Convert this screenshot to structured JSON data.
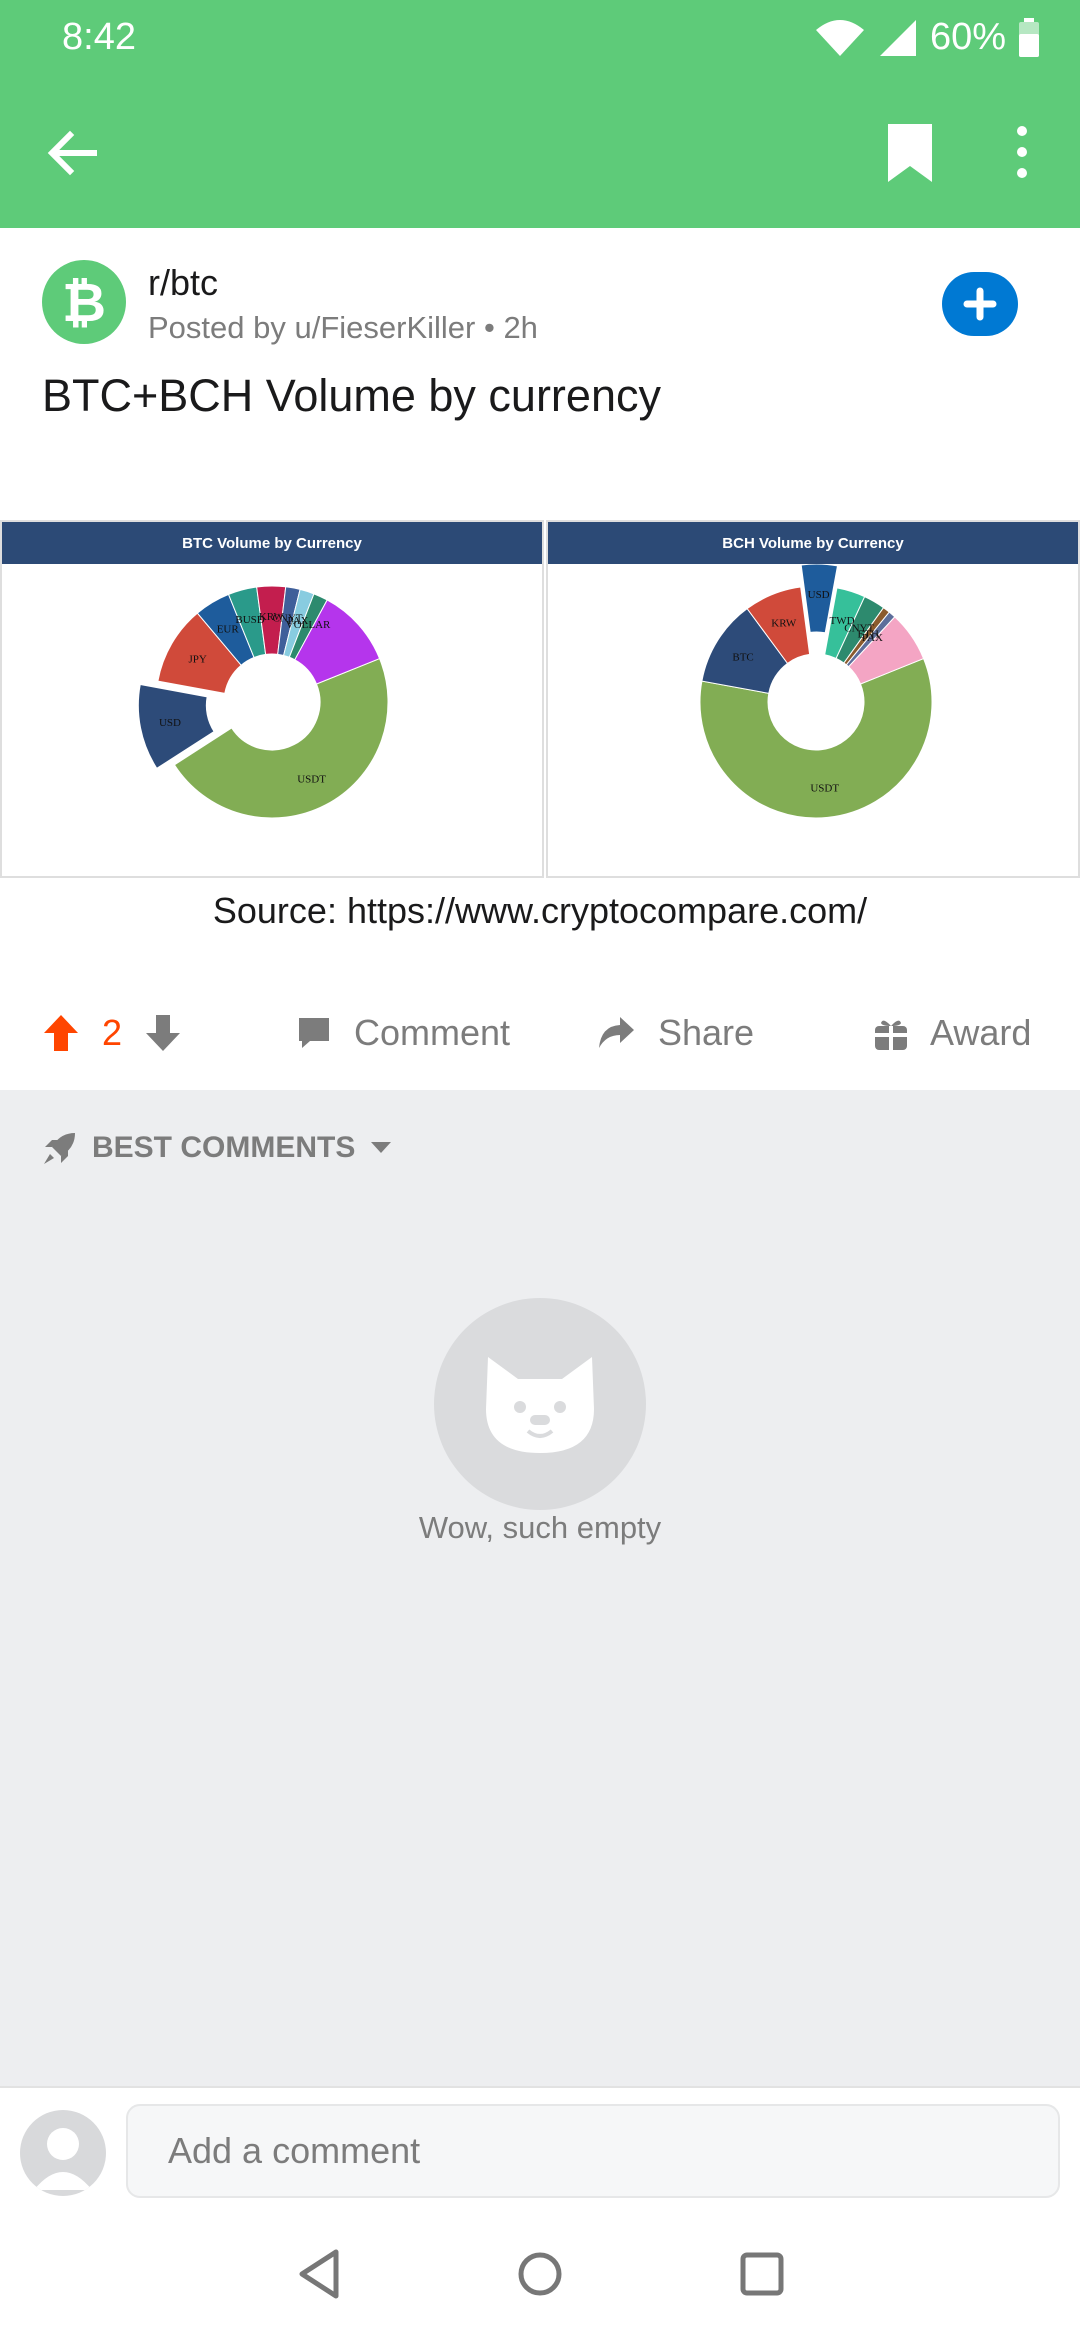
{
  "status_bar": {
    "time": "8:42",
    "battery": "60%"
  },
  "post": {
    "subreddit": "r/btc",
    "meta": "Posted by u/FieserKiller • 2h",
    "title": "BTC+BCH Volume by currency",
    "source": "Source: https://www.cryptocompare.com/"
  },
  "actions": {
    "vote_count": "2",
    "comment_label": "Comment",
    "share_label": "Share",
    "award_label": "Award"
  },
  "comments": {
    "sort_label": "BEST COMMENTS",
    "empty_text": "Wow, such empty",
    "input_placeholder": "Add a comment"
  },
  "colors": {
    "brand": "#5ecb79",
    "accent": "#0079d3",
    "upvote": "#ff4500"
  },
  "chart_data": [
    {
      "type": "pie",
      "title": "BTC Volume by Currency",
      "labels": [
        "USDT",
        "USD",
        "JPY",
        "EUR",
        "BUSD",
        "KRW",
        "CNYT",
        "PAX",
        "VOLLAR",
        "Other"
      ],
      "values": [
        47,
        12,
        11,
        5,
        4,
        4,
        2,
        2,
        2,
        11
      ],
      "colors": [
        "#82ad54",
        "#2d4b79",
        "#d04a3a",
        "#1e5c9c",
        "#2a9a8a",
        "#c31e4e",
        "#3f5f9a",
        "#88cce0",
        "#2d8a6e",
        "#b535ec"
      ]
    },
    {
      "type": "pie",
      "title": "BCH Volume by Currency",
      "labels": [
        "USDT",
        "BTC",
        "KRW",
        "USD",
        "TWD",
        "CNYT",
        "ETH",
        "PAX",
        "Other"
      ],
      "values": [
        59,
        12,
        8,
        5,
        4,
        3,
        1,
        1,
        7
      ],
      "colors": [
        "#82ad54",
        "#2d4b79",
        "#d04a3a",
        "#1e5c9c",
        "#36c09a",
        "#2d8a6e",
        "#8b5b2e",
        "#5d6e9b",
        "#f4a5c4"
      ]
    }
  ]
}
